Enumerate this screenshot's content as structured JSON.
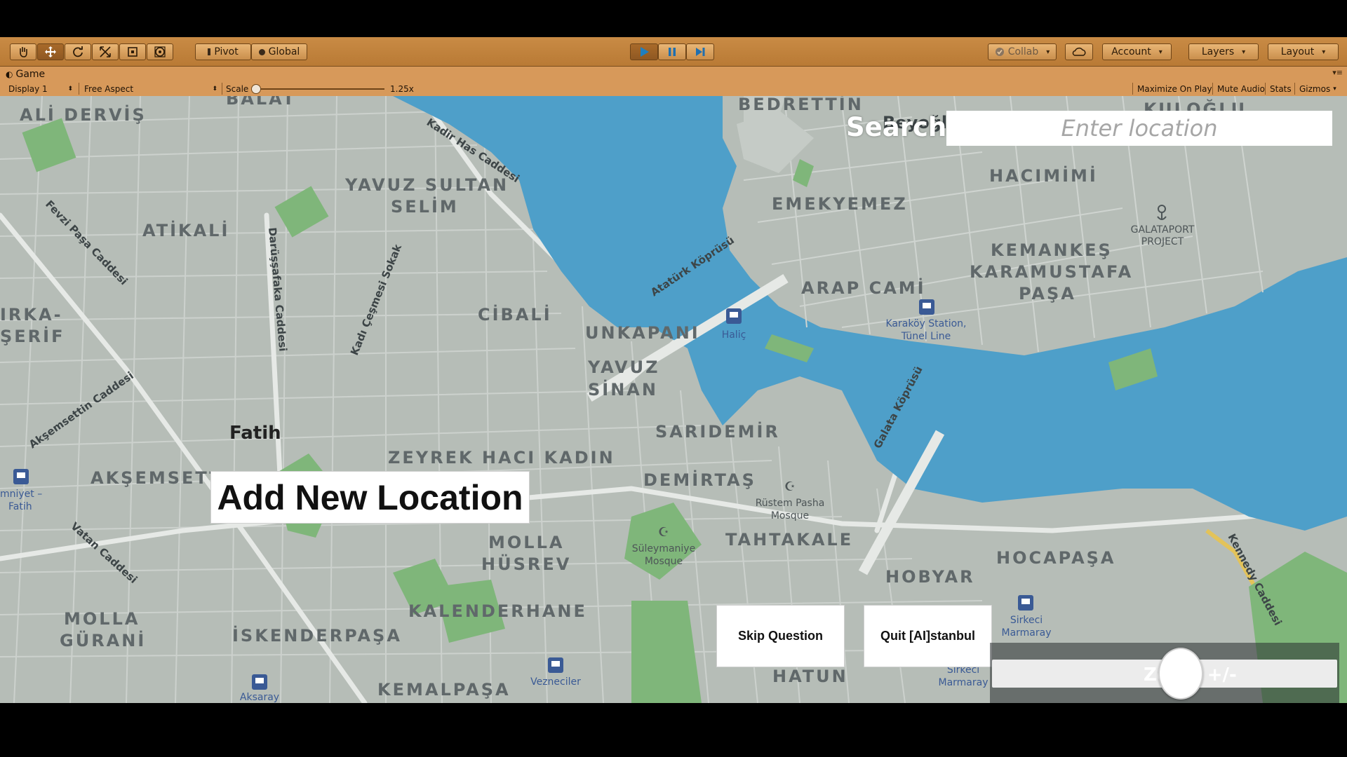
{
  "toolbar": {
    "pivot_label": "Pivot",
    "global_label": "Global",
    "collab_label": "Collab",
    "account_label": "Account",
    "layers_label": "Layers",
    "layout_label": "Layout"
  },
  "game_tab": {
    "title": "Game",
    "display": "Display 1",
    "aspect": "Free Aspect",
    "scale_label": "Scale",
    "scale_value": "1.25x",
    "maximize_label": "Maximize On Play",
    "mute_label": "Mute Audio",
    "stats_label": "Stats",
    "gizmos_label": "Gizmos"
  },
  "colors": {
    "editor_toolbar": "#c98b45",
    "water": "#4e9fc9",
    "land": "#b6bdb7",
    "park": "#7fb67a"
  },
  "map": {
    "districts": [
      "ALİ DERVİŞ",
      "BALAT",
      "BEDRETTİN",
      "KULOĞLU",
      "YAVUZ SULTAN",
      "SELİM",
      "HACIMİMİ",
      "ATİKALİ",
      "EMEKYEMEZ",
      "KEMANKEŞ",
      "KARAMUSTAFA",
      "PAŞA",
      "ARAP CAMİ",
      "IRKA-",
      "ŞERİF",
      "CİBALİ",
      "UNKAPANI",
      "YAVUZ",
      "SİNAN",
      "SARIDEMİR",
      "ZEYREK",
      "HACI KADIN",
      "DEMİRTAŞ",
      "AKŞEMSETT",
      "MOLLA",
      "HÜSREV",
      "TAHTAKALE",
      "HOBYAR",
      "HOCAPAŞA",
      "KALENDERHANE",
      "MOLLA",
      "GÜRANİ",
      "İSKENDERPAŞA",
      "HATUN",
      "KEMALPAŞA"
    ],
    "streets": [
      "Kadir Has Caddesi",
      "Fevzi Paşa Caddesi",
      "Darüşşafaka Caddesi",
      "Kadı Çeşmesi Sokak",
      "Atatürk Köprüsü",
      "Galata Köprüsü",
      "Akşemsettin Caddesi",
      "Vatan Caddesi",
      "Kennedy Caddesi"
    ],
    "pois": {
      "beyoglu": "Beyoğlu",
      "galataport_1": "GALATAPORT",
      "galataport_2": "PROJECT",
      "halic": "Haliç",
      "karakoy_1": "Karaköy Station,",
      "karakoy_2": "Tünel Line",
      "fatih": "Fatih",
      "emniyet_1": "mniyet –",
      "emniyet_2": "Fatih",
      "rustem_1": "Rüstem Pasha",
      "rustem_2": "Mosque",
      "suleymaniye_1": "Süleymaniye",
      "suleymaniye_2": "Mosque",
      "sirkeci_1": "Sirkeci",
      "sirkeci_2": "Marmaray",
      "sirkeci_3": "Sirkeci",
      "sirkeci_4": "Marmaray",
      "vezneciler": "Vezneciler",
      "aksaray": "Aksaray"
    }
  },
  "game_ui": {
    "search_label": "Search",
    "search_placeholder": "Enter location",
    "add_location": "Add New Location",
    "skip_question": "Skip Question",
    "quit": "Quit [AI]stanbul",
    "zoom_label": "Zoom +/-",
    "zoom_value": 0.5
  }
}
